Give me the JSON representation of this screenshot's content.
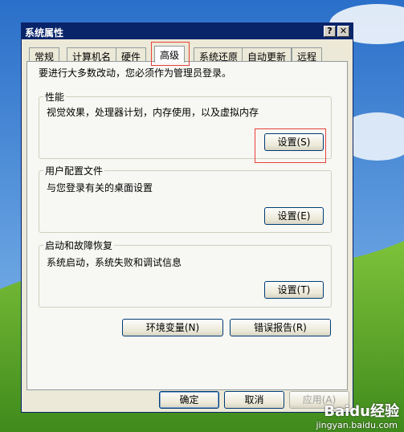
{
  "dialog": {
    "title": "系统属性",
    "help_glyph": "?",
    "close_glyph": "✕"
  },
  "tabs": [
    "常规",
    "计算机名",
    "硬件",
    "高级",
    "系统还原",
    "自动更新",
    "远程"
  ],
  "active_tab": "高级",
  "info_text": "要进行大多数改动，您必须作为管理员登录。",
  "groups": {
    "performance": {
      "title": "性能",
      "desc": "视觉效果，处理器计划，内存使用，以及虚拟内存",
      "button": "设置(S)"
    },
    "user_profiles": {
      "title": "用户配置文件",
      "desc": "与您登录有关的桌面设置",
      "button": "设置(E)"
    },
    "startup_recovery": {
      "title": "启动和故障恢复",
      "desc": "系统启动，系统失败和调试信息",
      "button": "设置(T)"
    }
  },
  "buttons": {
    "env_vars": "环境变量(N)",
    "error_report": "错误报告(R)",
    "ok": "确定",
    "cancel": "取消",
    "apply": "应用(A)"
  },
  "watermark": {
    "brand": "Baidu经验",
    "url": "jingyan.baidu.com"
  },
  "colors": {
    "titlebar": "#0a246a",
    "dialog_bg": "#ece9d8",
    "highlight": "#e8413c"
  }
}
